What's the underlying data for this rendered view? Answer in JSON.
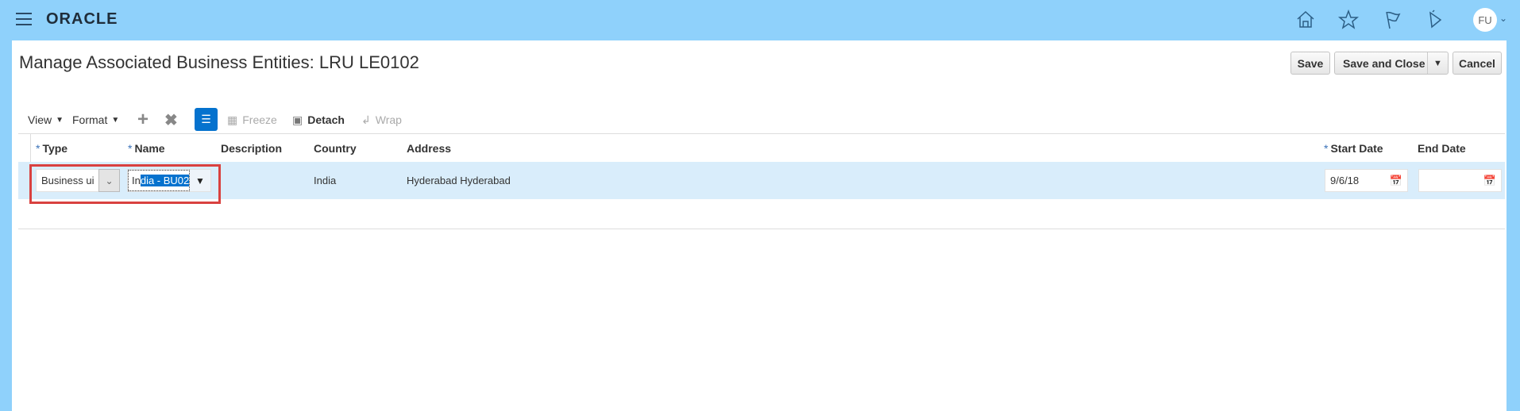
{
  "header": {
    "logo": "ORACLE",
    "avatar": "FU",
    "icons": [
      "menu-icon",
      "home-icon",
      "star-icon",
      "flag-icon",
      "bell-icon"
    ]
  },
  "page": {
    "title": "Manage Associated Business Entities: LRU LE0102"
  },
  "actions": {
    "save": "Save",
    "save_close": "Save and Close",
    "cancel": "Cancel"
  },
  "toolbar": {
    "view": "View",
    "format": "Format",
    "freeze": "Freeze",
    "detach": "Detach",
    "wrap": "Wrap"
  },
  "table": {
    "columns": [
      "Type",
      "Name",
      "Description",
      "Country",
      "Address",
      "Start Date",
      "End Date"
    ],
    "rows": [
      {
        "type": "Business ui",
        "name_unselected": "In",
        "name_selected": "dia - BU02",
        "description": "",
        "country": "India",
        "address": "Hyderabad Hyderabad",
        "start_date": "9/6/18",
        "end_date": ""
      }
    ]
  },
  "colors": {
    "header_bg": "#8fd1fb",
    "row_selected": "#d9edfb",
    "highlight_box": "#d9413f",
    "accent": "#0572ce"
  }
}
